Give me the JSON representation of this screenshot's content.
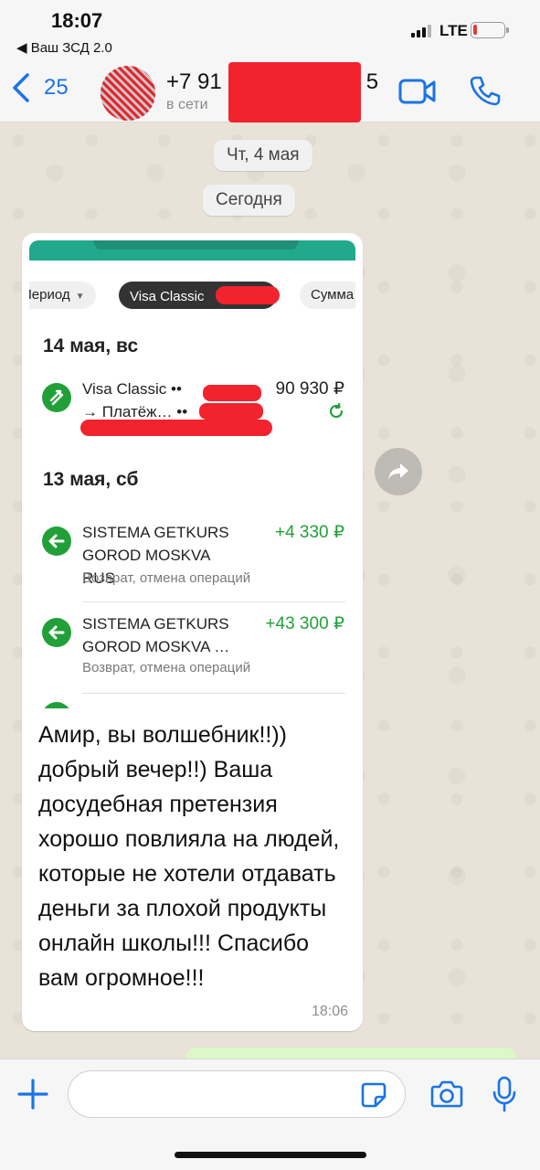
{
  "status_bar": {
    "time": "18:07",
    "back_app": "◀ Ваш ЗСД 2.0",
    "network": "LTE"
  },
  "header": {
    "back_count": "25",
    "contact_name": "+7 91",
    "contact_suffix": "5",
    "contact_status": "в сети"
  },
  "chat": {
    "date_pills": [
      "Чт, 4 мая",
      "Сегодня"
    ],
    "message": {
      "screenshot": {
        "chips": [
          "Период",
          "Visa Classic",
          "Сумма"
        ],
        "days": [
          {
            "title": "14 мая, вс",
            "transactions": [
              {
                "name_line1": "Visa Classic •• ",
                "name_line2": "→ Платёж…  •• ",
                "amount": "90 930 ₽",
                "color": "#222222"
              }
            ]
          },
          {
            "title": "13 мая, сб",
            "transactions": [
              {
                "name_line1": "SISTEMA GETKURS",
                "name_line2": "GOROD MOSKVA RUS",
                "amount": "+4 330 ₽",
                "sub": "Возврат, отмена операций",
                "color": "#21a038"
              },
              {
                "name_line1": "SISTEMA GETKURS",
                "name_line2": "GOROD MOSKVA …",
                "amount": "+43 300 ₽",
                "sub": "Возврат, отмена операций",
                "color": "#21a038"
              }
            ]
          }
        ]
      },
      "text": "Амир, вы волшебник!!)) добрый вечер!!) Ваша досудебная претензия хорошо повлияла на людей, которые не хотели отдавать деньги за плохой продукты онлайн школы!!! Спасибо вам огромное!!!",
      "time": "18:06"
    }
  },
  "input": {
    "value": "",
    "placeholder": ""
  },
  "colors": {
    "accent": "#1a73e8",
    "sber_green": "#21a038",
    "redaction": "#f3232e"
  }
}
